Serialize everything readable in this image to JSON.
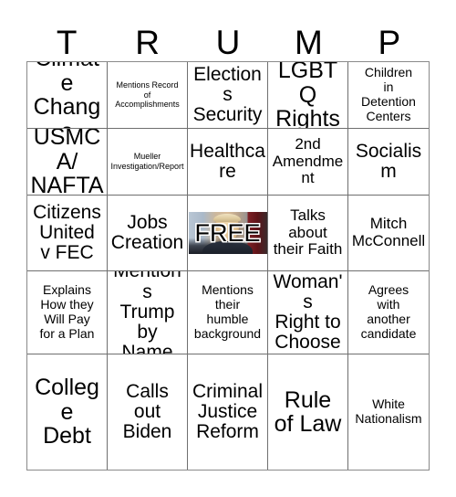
{
  "card": {
    "header_letters": [
      "T",
      "R",
      "U",
      "M",
      "P"
    ],
    "free_space_label": "FREE",
    "grid": {
      "rows": 5,
      "columns": 5,
      "cells": [
        {
          "text": "Climate\nChange",
          "size": "xl"
        },
        {
          "text": "Mentions Record\nof\nAccomplishments",
          "size": "xxs"
        },
        {
          "text": "Elections\nSecurity",
          "size": "lg"
        },
        {
          "text": "LGBTQ\nRights",
          "size": "xl"
        },
        {
          "text": "Children\nin\nDetention\nCenters",
          "size": "sm"
        },
        {
          "text": "USMCA/\nNAFTA",
          "size": "xl"
        },
        {
          "text": "Mueller\nInvestigation/Report",
          "size": "xxs"
        },
        {
          "text": "Healthcare",
          "size": "lg"
        },
        {
          "text": "2nd\nAmendment",
          "size": "md"
        },
        {
          "text": "Socialism",
          "size": "lg"
        },
        {
          "text": "Citizens\nUnited\nv FEC",
          "size": "lg"
        },
        {
          "text": "Jobs\nCreation",
          "size": "lg"
        },
        {
          "text": "FREE",
          "size": "free"
        },
        {
          "text": "Talks\nabout\ntheir Faith",
          "size": "md"
        },
        {
          "text": "Mitch\nMcConnell",
          "size": "md"
        },
        {
          "text": "Explains\nHow they\nWill Pay\nfor a Plan",
          "size": "sm"
        },
        {
          "text": "Mentions\nTrump by\nName",
          "size": "lg"
        },
        {
          "text": "Mentions\ntheir\nhumble\nbackground",
          "size": "sm"
        },
        {
          "text": "Woman's\nRight to\nChoose",
          "size": "lg"
        },
        {
          "text": "Agrees\nwith\nanother\ncandidate",
          "size": "sm"
        },
        {
          "text": "College\nDebt",
          "size": "xl"
        },
        {
          "text": "Calls\nout\nBiden",
          "size": "lg"
        },
        {
          "text": "Criminal\nJustice\nReform",
          "size": "lg"
        },
        {
          "text": "Rule\nof Law",
          "size": "xl"
        },
        {
          "text": "White\nNationalism",
          "size": "sm"
        }
      ]
    }
  },
  "colors": {
    "page_background": "#ffffff",
    "text": "#000000",
    "grid_line": "#6f6f6f",
    "grid_outer_border": "#8a8a8a",
    "free_outline": "#ffffff",
    "free_photo_red": "#7c1f24",
    "free_photo_blue": "#b9c6d4"
  }
}
